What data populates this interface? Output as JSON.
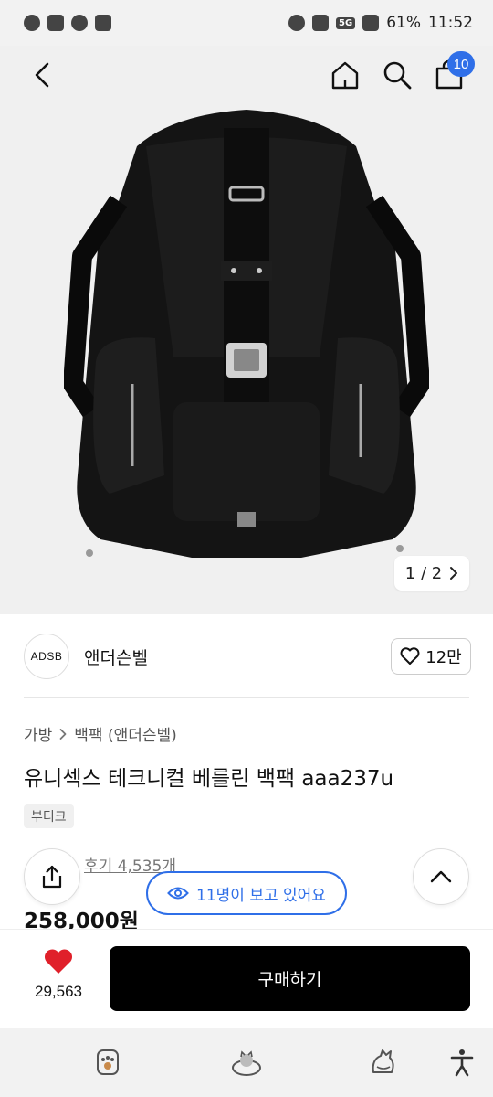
{
  "status_bar": {
    "battery": "61%",
    "time": "11:52",
    "network": "5G",
    "left_icons": [
      "talk-icon",
      "instagram-icon",
      "pill-icon",
      "app-icon"
    ],
    "right_icons": [
      "alarm-icon",
      "mute-icon",
      "volte-icon",
      "signal-icon"
    ]
  },
  "nav": {
    "cart_count": "10"
  },
  "gallery": {
    "current": "1",
    "total": "2",
    "pager_text": "1 / 2"
  },
  "brand": {
    "logo_text": "ADSB",
    "name": "앤더슨벨",
    "likes": "12만"
  },
  "product": {
    "breadcrumb": [
      "가방",
      "백팩 (앤더슨벨)"
    ],
    "title": "유니섹스 테크니컬 베를린 백팩 aaa237u",
    "tag": "부티크",
    "review": "후기 4,535개",
    "price": "258,000원"
  },
  "overlay": {
    "viewers": "11명이 보고 있어요"
  },
  "bottom": {
    "wish_count": "29,563",
    "buy_label": "구매하기"
  },
  "colors": {
    "accent": "#2f6fe8",
    "heart": "#e0202a",
    "buy_button": "#000000"
  }
}
